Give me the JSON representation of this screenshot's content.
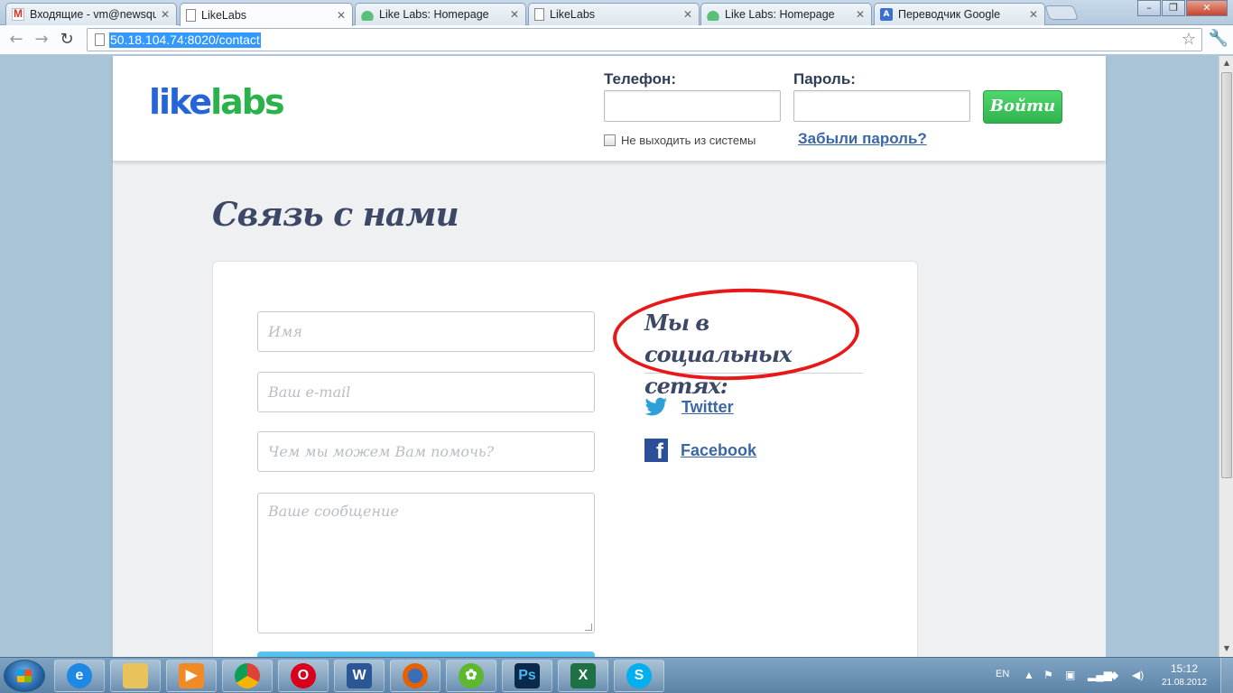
{
  "browser": {
    "tabs": [
      {
        "label": "Входящие - vm@newsqua",
        "icon": "gmail-icon",
        "active": false
      },
      {
        "label": "LikeLabs",
        "icon": "page-icon",
        "active": true
      },
      {
        "label": "Like Labs: Homepage",
        "icon": "cloud-icon",
        "active": false
      },
      {
        "label": "LikeLabs",
        "icon": "page-icon",
        "active": false
      },
      {
        "label": "Like Labs: Homepage",
        "icon": "cloud-icon",
        "active": false
      },
      {
        "label": "Переводчик Google",
        "icon": "translate-icon",
        "active": false
      }
    ],
    "url": "50.18.104.74:8020/contact"
  },
  "site": {
    "logo": {
      "part1": "like",
      "part2": "labs"
    },
    "login": {
      "phone_label": "Телефон:",
      "password_label": "Пароль:",
      "submit_label": "Войти",
      "remember_label": "Не выходить из системы",
      "forgot_link": "Забыли пароль?"
    },
    "page_title": "Связь с нами",
    "form": {
      "name_placeholder": "Имя",
      "email_placeholder": "Ваш e-mail",
      "subject_placeholder": "Чем мы можем Вам помочь?",
      "message_placeholder": "Ваше сообщение"
    },
    "social": {
      "title": "Мы в социальных сетях:",
      "links": [
        {
          "label": "Twitter",
          "icon": "twitter-icon"
        },
        {
          "label": "Facebook",
          "icon": "facebook-icon"
        }
      ]
    }
  },
  "taskbar": {
    "apps": [
      "internet-explorer-icon",
      "file-explorer-icon",
      "media-player-icon",
      "chrome-icon",
      "opera-icon",
      "word-icon",
      "firefox-icon",
      "icq-icon",
      "photoshop-icon",
      "excel-icon",
      "skype-icon"
    ],
    "language": "EN",
    "time": "15:12",
    "date": "21.08.2012"
  },
  "colors": {
    "logo_like": "#2564d9",
    "logo_labs": "#2bb34b",
    "login_button": "#3ac75b",
    "heading": "#3c4866",
    "link": "#3a67a8",
    "annotation_circle": "#e81818"
  }
}
